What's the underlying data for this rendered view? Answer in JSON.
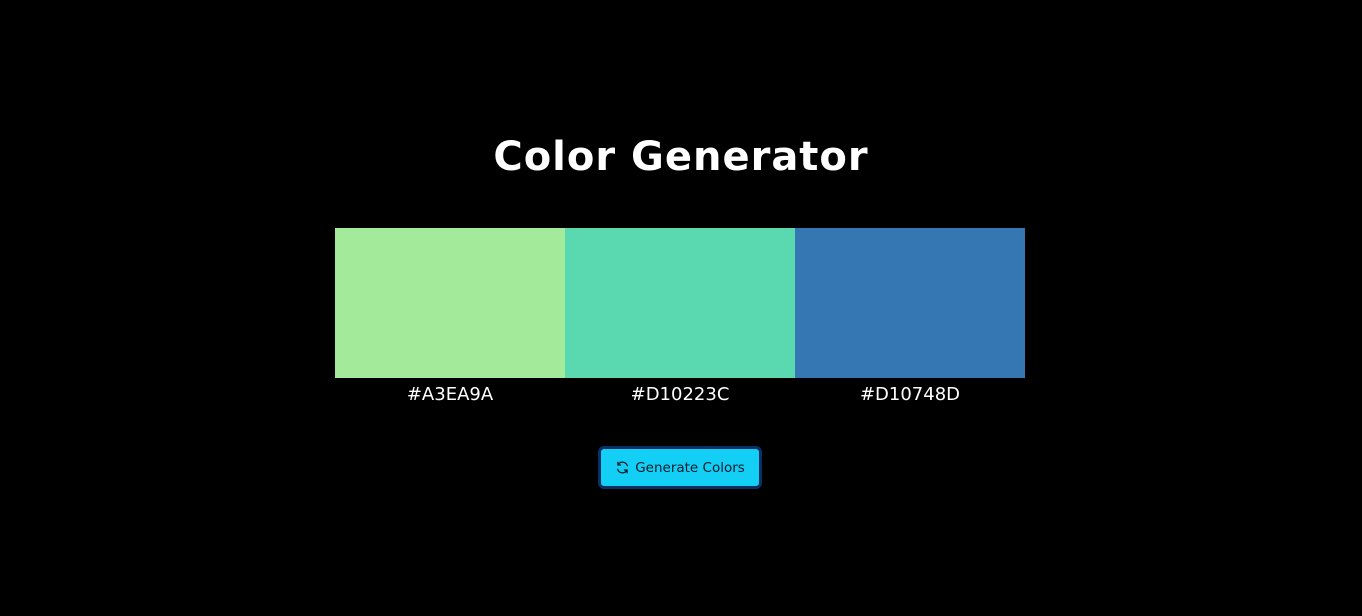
{
  "page": {
    "title": "Color Generator",
    "background": "#000000"
  },
  "palette": {
    "swatches": [
      {
        "color": "#A3EA9A",
        "label": "#A3EA9A"
      },
      {
        "color": "#5AD8B0",
        "label": "#D10223C"
      },
      {
        "color": "#3477B3",
        "label": "#D10748D"
      }
    ]
  },
  "generate_button": {
    "label": "Generate Colors",
    "icon": "refresh-icon",
    "background": "#14CFF5",
    "border": "#0B2F63"
  }
}
